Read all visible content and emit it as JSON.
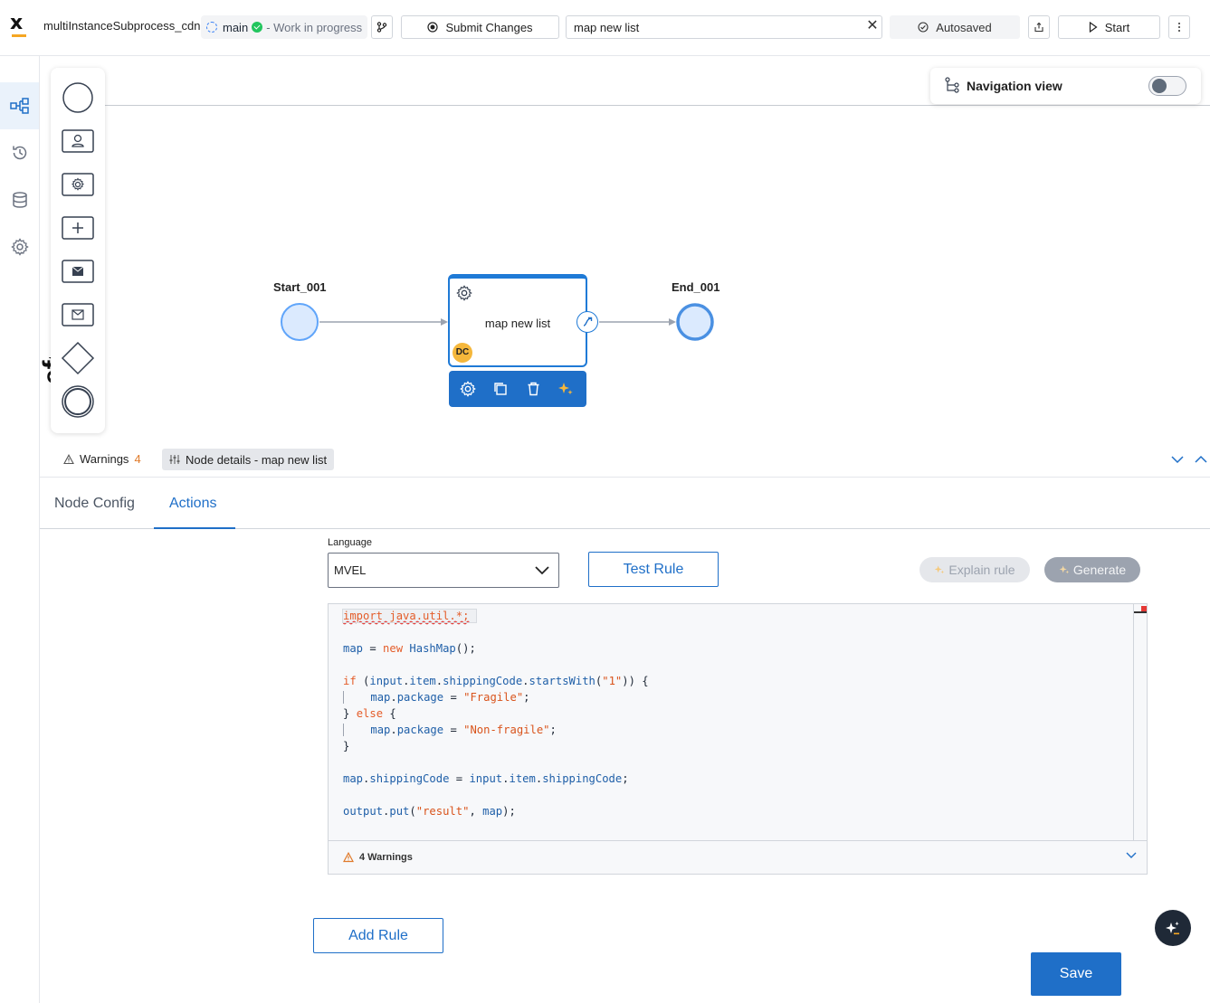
{
  "header": {
    "process_name": "multiInstanceSubprocess_cdn",
    "branch": "main",
    "status": "- Work in progress",
    "submit_label": "Submit Changes",
    "search_value": "map new list",
    "autosaved_label": "Autosaved",
    "start_label": "Start"
  },
  "navigation_view": {
    "label": "Navigation view",
    "enabled": false
  },
  "diagram": {
    "start_label": "Start_001",
    "task_label": "map new list",
    "task_assignee": "DC",
    "end_label": "End_001",
    "canvas_vertical_text": "efault"
  },
  "bottom_panel": {
    "warnings_label": "Warnings",
    "warnings_count": "4",
    "details_label": "Node details - map new list",
    "tabs": [
      {
        "label": "Node Config",
        "active": false
      },
      {
        "label": "Actions",
        "active": true
      }
    ]
  },
  "rule_editor": {
    "language_label": "Language",
    "language_value": "MVEL",
    "test_rule_label": "Test Rule",
    "explain_rule_label": "Explain rule",
    "generate_label": "Generate",
    "code_lines": [
      "import java.util.*;",
      "",
      "map = new HashMap();",
      "",
      "if (input.item.shippingCode.startsWith(\"1\")) {",
      "    map.package = \"Fragile\";",
      "} else {",
      "    map.package = \"Non-fragile\";",
      "}",
      "",
      "map.shippingCode = input.item.shippingCode;",
      "",
      "output.put(\"result\", map);"
    ],
    "warnings_footer": "4 Warnings",
    "add_rule_label": "Add Rule",
    "save_label": "Save"
  },
  "colors": {
    "primary": "#1f6fc8",
    "accent": "#f5a623",
    "warning": "#e07a2a",
    "success": "#22c55e"
  }
}
